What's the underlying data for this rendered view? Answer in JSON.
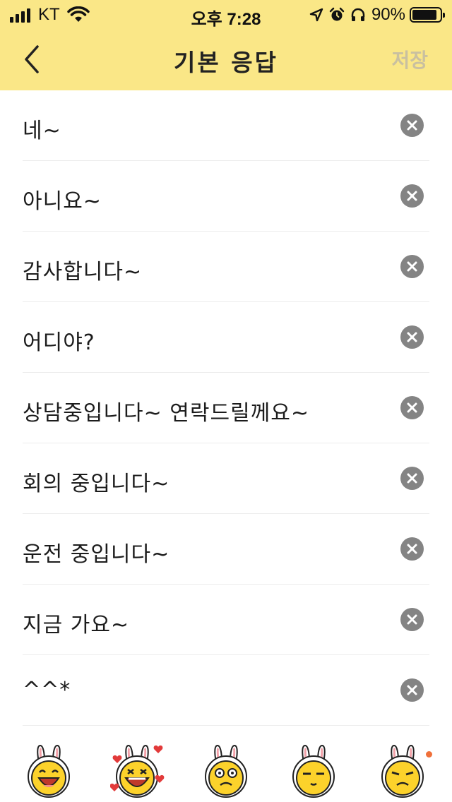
{
  "status_bar": {
    "carrier": "KT",
    "time": "오후 7:28",
    "battery_percent": "90%",
    "battery_level": 0.9,
    "icons": [
      "signal-icon",
      "wifi-icon",
      "location-arrow-icon",
      "alarm-icon",
      "headphones-icon",
      "battery-icon"
    ]
  },
  "nav": {
    "back_icon": "chevron-left-icon",
    "title": "기본 응답",
    "save_label": "저장"
  },
  "responses": [
    {
      "text": "네~"
    },
    {
      "text": "아니요~"
    },
    {
      "text": "감사합니다~"
    },
    {
      "text": "어디야?"
    },
    {
      "text": "상담중입니다~ 연락드릴께요~"
    },
    {
      "text": "회의 중입니다~"
    },
    {
      "text": "운전 중입니다~"
    },
    {
      "text": "지금 가요~"
    },
    {
      "text": "^^*"
    }
  ],
  "emoticons": [
    "laughing-bunny-emoticon",
    "heart-bunny-emoticon",
    "dizzy-bunny-emoticon",
    "smug-bunny-emoticon",
    "grumpy-bunny-emoticon"
  ],
  "colors": {
    "header_bg": "#fae787",
    "save_disabled": "#c9c0a0",
    "delete_bg": "#848484",
    "badge_dot": "#f0703a"
  }
}
